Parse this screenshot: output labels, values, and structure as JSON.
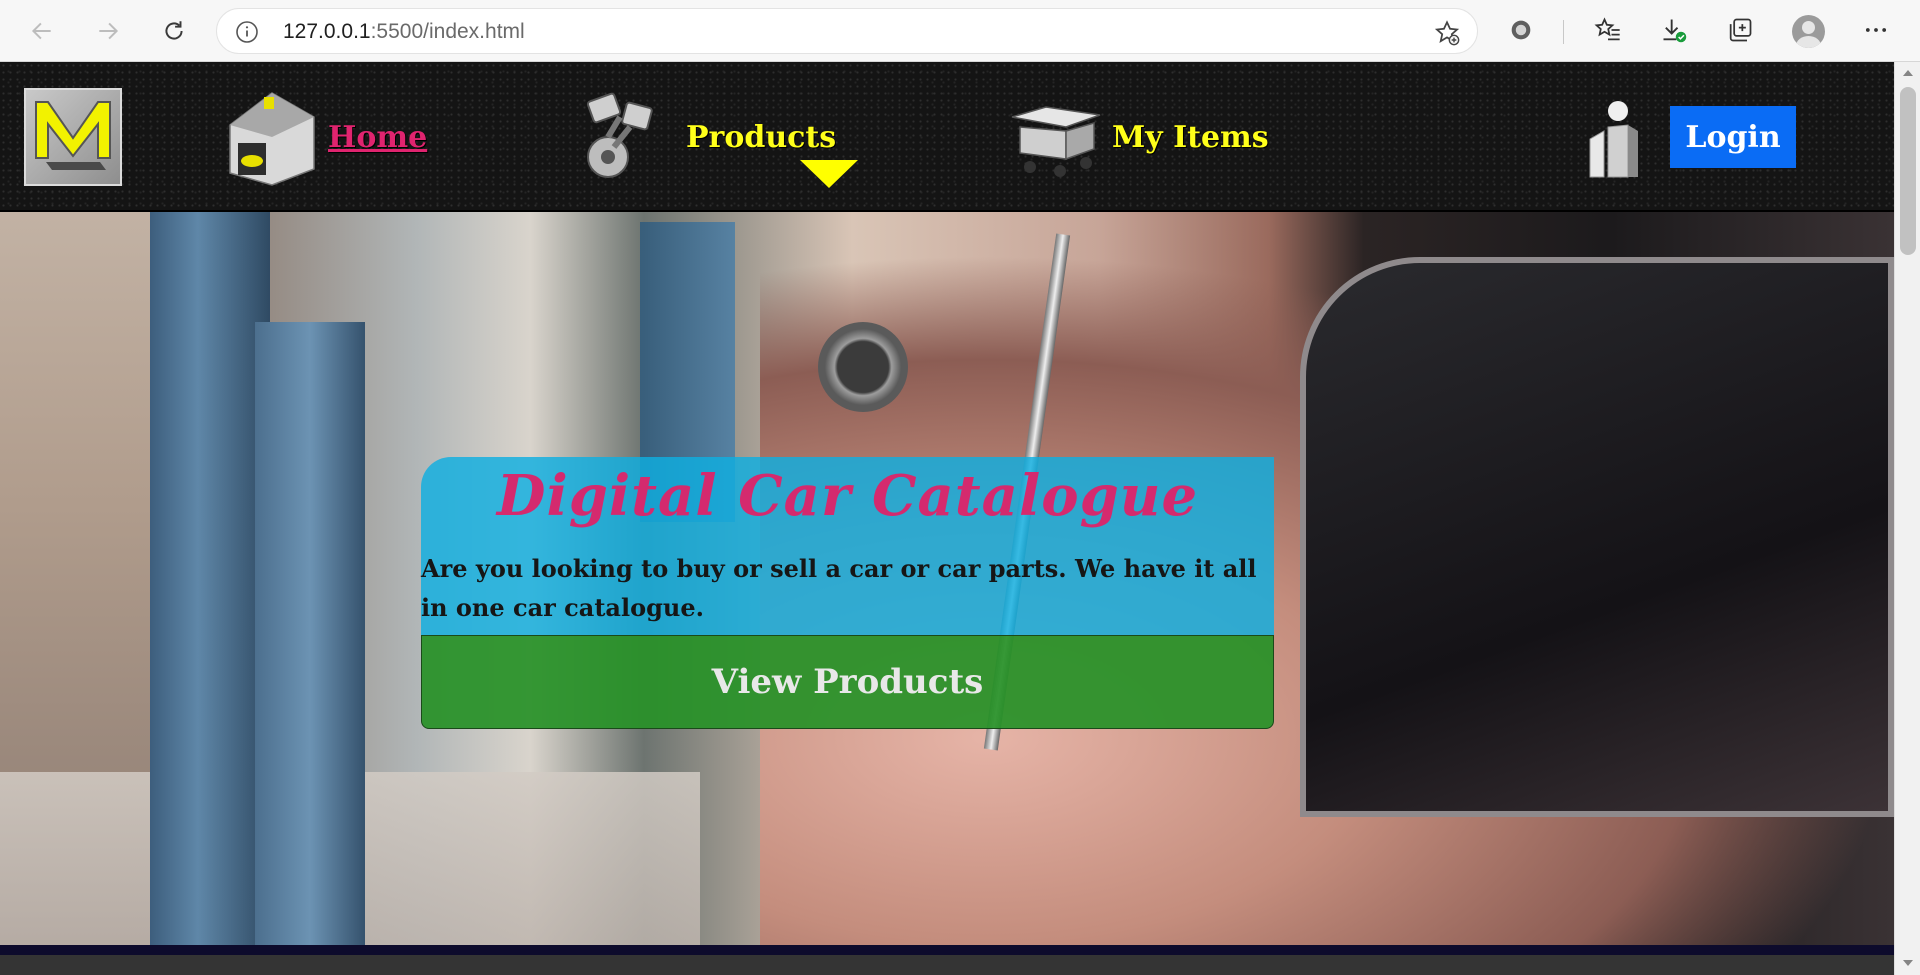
{
  "browser": {
    "url_host": "127.0.0.1",
    "url_rest": ":5500/index.html",
    "icons": [
      "back-icon",
      "forward-icon",
      "refresh-icon",
      "info-icon",
      "add-favorite-icon",
      "extension-icon",
      "favorites-icon",
      "downloads-icon",
      "collections-icon",
      "profile-avatar",
      "more-icon"
    ]
  },
  "nav": {
    "home_label": "Home",
    "products_label": "Products",
    "my_items_label": "My Items",
    "login_label": "Login"
  },
  "hero": {
    "title": "Digital Car Catalogue",
    "text": "Are you looking to buy or sell a car or car parts. We have it all in one car catalogue.",
    "cta_label": "View Products"
  },
  "colors": {
    "nav_text": "#ffff1a",
    "nav_active": "#e0246f",
    "login_bg": "#0a6cf5",
    "card_bg": "#0fafe1",
    "title_color": "#d42a6e",
    "cta_bg": "#289128"
  }
}
